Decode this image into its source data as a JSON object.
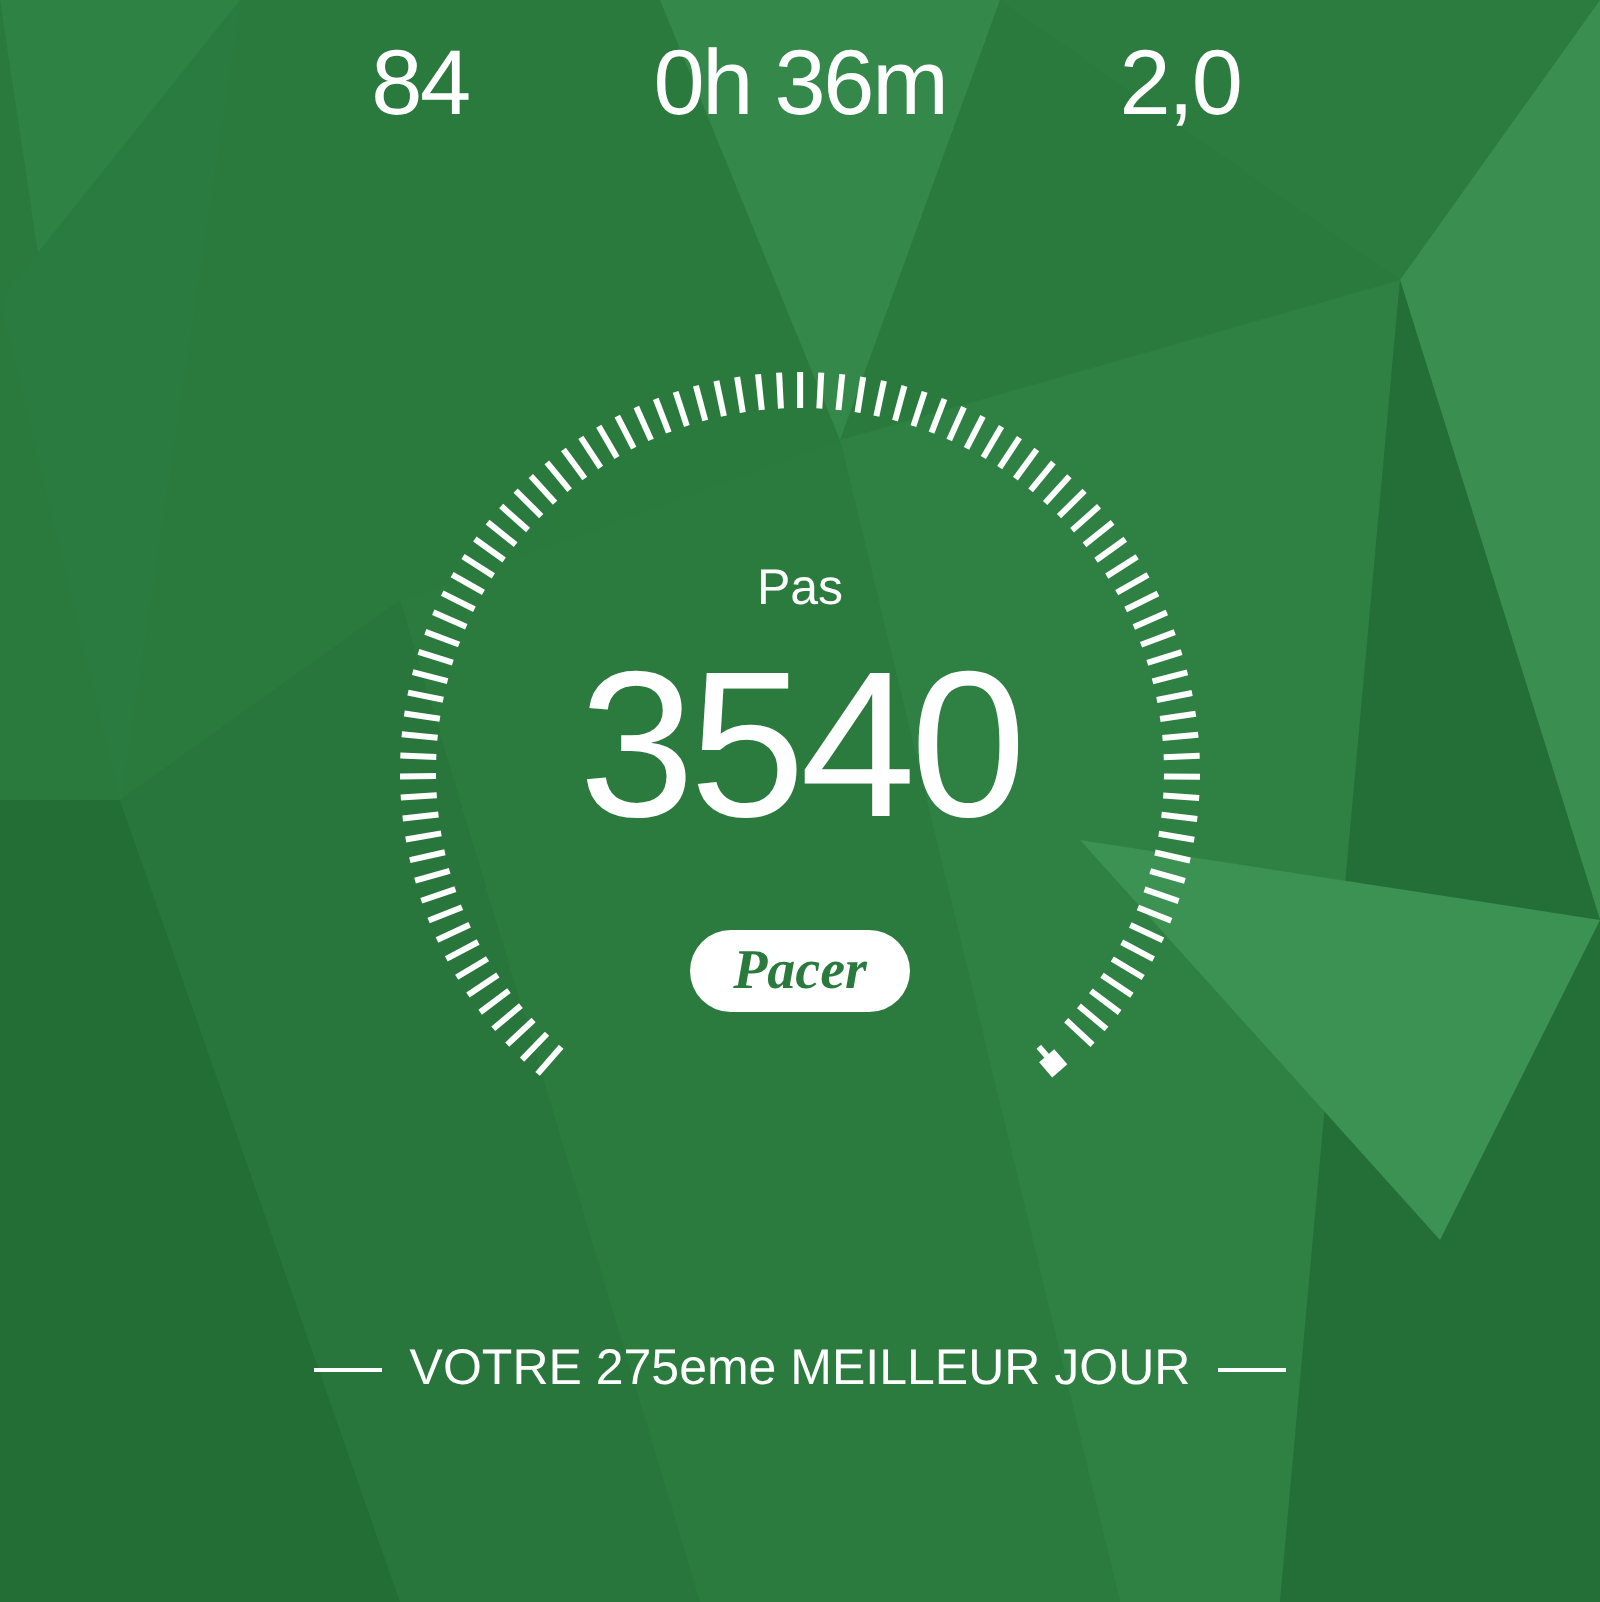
{
  "stats": [
    {
      "value": "84"
    },
    {
      "value": "0h 36m"
    },
    {
      "value": "2,0"
    }
  ],
  "gauge": {
    "label": "Pas",
    "value": "3540",
    "badge": "Pacer"
  },
  "footer": {
    "text": "VOTRE 275eme MEILLEUR JOUR"
  }
}
